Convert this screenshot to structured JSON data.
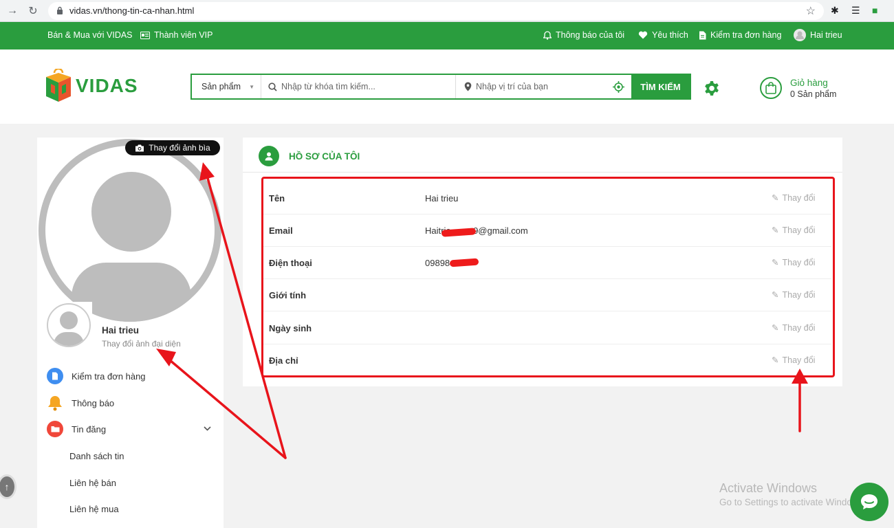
{
  "browser": {
    "url": "vidas.vn/thong-tin-ca-nhan.html"
  },
  "topbar": {
    "buy_sell": "Bán & Mua với VIDAS",
    "vip": "Thành viên VIP",
    "notifications": "Thông báo của tôi",
    "favorites": "Yêu thích",
    "orders": "Kiểm tra đơn hàng",
    "user": "Hai trieu"
  },
  "header": {
    "logo": "VIDAS",
    "search": {
      "category": "Sản phẩm",
      "keyword_placeholder": "Nhập từ khóa tìm kiếm...",
      "location_placeholder": "Nhập vị trí của bạn",
      "button": "TÌM KIẾM"
    },
    "cart": {
      "title": "Giỏ hàng",
      "count": "0 Sản phẩm"
    }
  },
  "sidebar": {
    "cover_button": "Thay đổi ảnh bìa",
    "user_name": "Hai trieu",
    "change_avatar": "Thay đổi ảnh đại diện",
    "menu": [
      {
        "label": "Kiểm tra đơn hàng",
        "color": "#3f8ef0"
      },
      {
        "label": "Thông báo",
        "color": "#f5a623"
      },
      {
        "label": "Tin đăng",
        "color": "#f0473a"
      }
    ],
    "submenu": [
      "Danh sách tin",
      "Liên hệ bán",
      "Liên hệ mua"
    ]
  },
  "profile": {
    "title": "HỒ SƠ CỦA TÔI",
    "edit_label": "Thay đổi",
    "rows": [
      {
        "label": "Tên",
        "value": "Hai trieu"
      },
      {
        "label": "Email",
        "value": "Haitrie         9@gmail.com"
      },
      {
        "label": "Điện thoại",
        "value": "09898"
      },
      {
        "label": "Giới tính",
        "value": ""
      },
      {
        "label": "Ngày sinh",
        "value": ""
      },
      {
        "label": "Địa chỉ",
        "value": ""
      }
    ]
  },
  "watermark": {
    "line1": "Activate Windows",
    "line2": "Go to Settings to activate Windows."
  },
  "colors": {
    "brand_green": "#2a9d3e",
    "annotation_red": "#e8141b"
  }
}
